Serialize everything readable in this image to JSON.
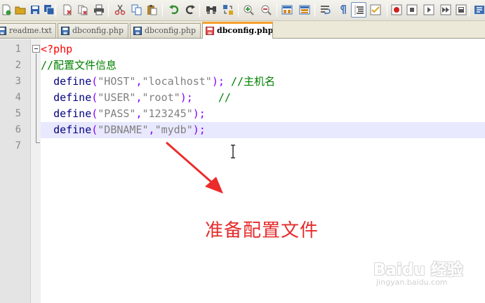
{
  "toolbar": {
    "buttons": [
      {
        "name": "new-file-icon",
        "color": "#3a9a3a"
      },
      {
        "name": "open-file-icon",
        "color": "#d9a520"
      },
      {
        "name": "save-icon",
        "color": "#2d5fa8"
      },
      {
        "name": "save-all-icon",
        "color": "#2d5fa8"
      },
      {
        "name": "close-icon",
        "color": "#c84040"
      },
      {
        "name": "close-all-icon",
        "color": "#c84040"
      },
      {
        "name": "print-icon",
        "color": "#555555"
      },
      {
        "name": "cut-icon",
        "color": "#c84040"
      },
      {
        "name": "copy-icon",
        "color": "#3b6fb4"
      },
      {
        "name": "paste-icon",
        "color": "#b08430"
      },
      {
        "name": "undo-icon",
        "color": "#2f8f2f"
      },
      {
        "name": "redo-icon",
        "color": "#2f8f2f"
      },
      {
        "name": "find-icon",
        "color": "#444444"
      },
      {
        "name": "replace-icon",
        "color": "#3b6fb4"
      },
      {
        "name": "zoom-in-icon",
        "color": "#3a9a3a"
      },
      {
        "name": "zoom-out-icon",
        "color": "#c84040"
      },
      {
        "name": "sync-vertical-icon",
        "color": "#d98a20"
      },
      {
        "name": "sync-horizontal-icon",
        "color": "#d98a20"
      },
      {
        "name": "word-wrap-icon",
        "color": "#3b6fb4"
      },
      {
        "name": "show-all-characters-icon",
        "color": "#3b6fb4"
      },
      {
        "name": "indent-guide-icon",
        "color": "#333333"
      },
      {
        "name": "user-defined-language-icon",
        "color": "#d9a520"
      },
      {
        "name": "macro-record-icon",
        "color": "#d02020"
      },
      {
        "name": "macro-stop-icon",
        "color": "#555555"
      },
      {
        "name": "macro-play-icon",
        "color": "#555555"
      },
      {
        "name": "macro-play-multiple-icon",
        "color": "#555555"
      },
      {
        "name": "macro-save-icon",
        "color": "#555555"
      },
      {
        "name": "run-icon",
        "color": "#3b6fb4"
      }
    ]
  },
  "tabs": [
    {
      "label": "readme.txt",
      "state": "saved",
      "icon": "file-saved-icon",
      "active": false
    },
    {
      "label": "dbconfig.php",
      "state": "saved",
      "icon": "file-saved-icon",
      "active": false
    },
    {
      "label": "dbconfig.php",
      "state": "saved",
      "icon": "file-saved-icon",
      "active": false
    },
    {
      "label": "dbconfig.php",
      "state": "unsaved",
      "icon": "file-unsaved-icon",
      "active": true
    }
  ],
  "editor": {
    "current_line": 6,
    "lines": [
      {
        "number": "1",
        "tokens": [
          {
            "t": "<?php",
            "c": "php"
          }
        ]
      },
      {
        "number": "2",
        "tokens": [
          {
            "t": "//配置文件信息",
            "c": "comment"
          }
        ]
      },
      {
        "number": "3",
        "tokens": [
          {
            "t": "  ",
            "c": "plain"
          },
          {
            "t": "define",
            "c": "fn"
          },
          {
            "t": "(",
            "c": "op"
          },
          {
            "t": "\"HOST\"",
            "c": "str"
          },
          {
            "t": ",",
            "c": "op"
          },
          {
            "t": "\"localhost\"",
            "c": "str"
          },
          {
            "t": ");",
            "c": "op"
          },
          {
            "t": " ",
            "c": "plain"
          },
          {
            "t": "//主机名",
            "c": "comment"
          }
        ]
      },
      {
        "number": "4",
        "tokens": [
          {
            "t": "  ",
            "c": "plain"
          },
          {
            "t": "define",
            "c": "fn"
          },
          {
            "t": "(",
            "c": "op"
          },
          {
            "t": "\"USER\"",
            "c": "str"
          },
          {
            "t": ",",
            "c": "op"
          },
          {
            "t": "\"root\"",
            "c": "str"
          },
          {
            "t": ");",
            "c": "op"
          },
          {
            "t": "    ",
            "c": "plain"
          },
          {
            "t": "//",
            "c": "comment"
          }
        ]
      },
      {
        "number": "5",
        "tokens": [
          {
            "t": "  ",
            "c": "plain"
          },
          {
            "t": "define",
            "c": "fn"
          },
          {
            "t": "(",
            "c": "op"
          },
          {
            "t": "\"PASS\"",
            "c": "str"
          },
          {
            "t": ",",
            "c": "op"
          },
          {
            "t": "\"123245\"",
            "c": "str"
          },
          {
            "t": ");",
            "c": "op"
          }
        ]
      },
      {
        "number": "6",
        "tokens": [
          {
            "t": "  ",
            "c": "plain"
          },
          {
            "t": "define",
            "c": "fn"
          },
          {
            "t": "(",
            "c": "op"
          },
          {
            "t": "\"DBNAME\"",
            "c": "str"
          },
          {
            "t": ",",
            "c": "op"
          },
          {
            "t": "\"mydb\"",
            "c": "str"
          },
          {
            "t": ");",
            "c": "op"
          }
        ]
      },
      {
        "number": "7",
        "tokens": []
      }
    ]
  },
  "annotation": {
    "text": "准备配置文件",
    "color": "#e52b2b"
  },
  "watermark": {
    "logo": "Baidu 经验",
    "url": "jingyan.baidu.com"
  }
}
